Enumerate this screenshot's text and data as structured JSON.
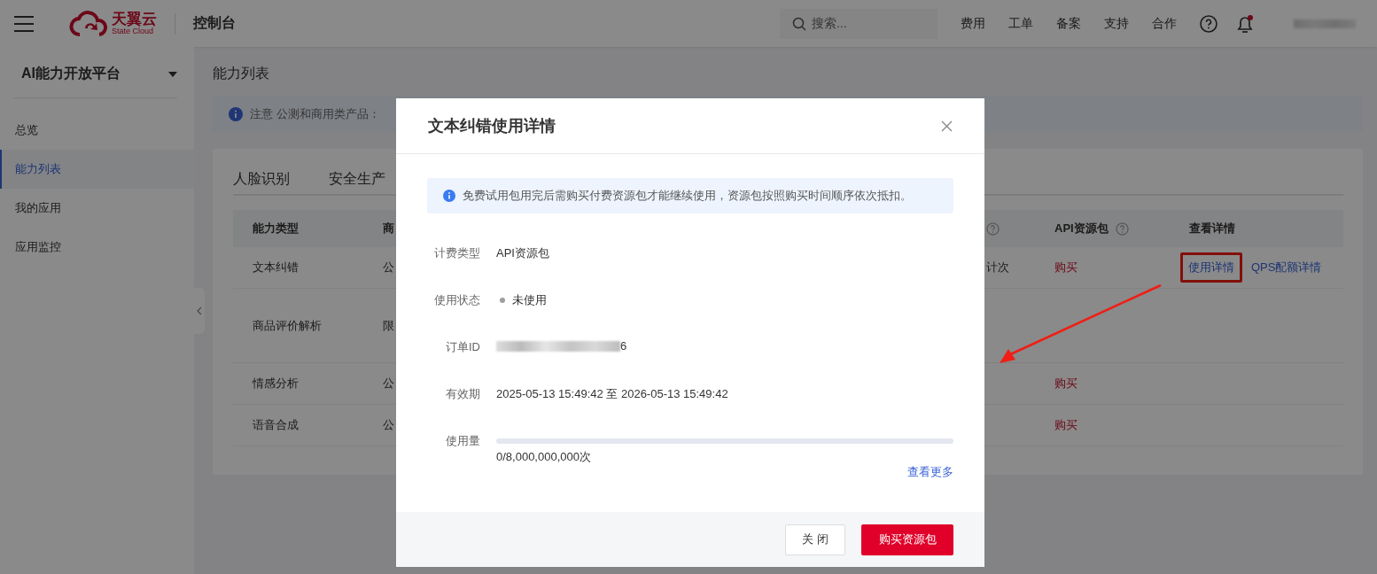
{
  "topbar": {
    "logo": {
      "name": "天翼云",
      "tagline": "State Cloud"
    },
    "title": "控制台",
    "search": {
      "placeholder": "搜索..."
    },
    "links": [
      "费用",
      "工单",
      "备案",
      "支持",
      "合作"
    ],
    "notifications": {
      "unread": true
    }
  },
  "sidebar": {
    "platform": "AI能力开放平台",
    "items": [
      {
        "label": "总览",
        "selected": false
      },
      {
        "label": "能力列表",
        "selected": true
      },
      {
        "label": "我的应用",
        "selected": false
      },
      {
        "label": "应用监控",
        "selected": false
      }
    ]
  },
  "page_title": "能力列表",
  "notice": "注意 公测和商用类产品：",
  "tabs": [
    {
      "label": "人脸识别",
      "selected": false
    },
    {
      "label": "安全生产",
      "selected": false
    }
  ],
  "table": {
    "columns": [
      {
        "label": "能力类型"
      },
      {
        "label": "商"
      },
      {
        "help": true
      },
      {
        "label": "API资源包",
        "help": true
      },
      {
        "label": "查看详情"
      }
    ],
    "rows": [
      {
        "type": "文本纠错",
        "column_2": "公",
        "column_3": "计次",
        "buy": "购买",
        "details": [
          {
            "label": "使用详情",
            "highlighted": true
          },
          {
            "label": "QPS配额详情",
            "highlighted": false
          }
        ]
      },
      {
        "type": "商品评价解析",
        "column_2": "限",
        "tall": true
      },
      {
        "type": "情感分析",
        "column_2": "公",
        "buy": "购买"
      },
      {
        "type": "语音合成",
        "column_2": "公",
        "buy": "购买"
      }
    ]
  },
  "modal": {
    "title": "文本纠错使用详情",
    "notice": "免费试用包用完后需购买付费资源包才能继续使用，资源包按照购买时间顺序依次抵扣。",
    "fields": [
      {
        "kind": "text",
        "label": "计费类型",
        "value": "API资源包"
      },
      {
        "kind": "status",
        "label": "使用状态",
        "value": "未使用",
        "color": "#9e9e9e"
      },
      {
        "kind": "redacted",
        "label": "订单ID",
        "value": "6"
      },
      {
        "kind": "text",
        "label": "有效期",
        "value": "2025-05-13 15:49:42 至 2026-05-13 15:49:42"
      },
      {
        "kind": "usage",
        "label": "使用量",
        "level": 0,
        "value": "0/8,000,000,000次"
      }
    ],
    "more_link": "查看更多",
    "buttons": [
      {
        "label": "关 闭",
        "kind": "secondary"
      },
      {
        "label": "购买资源包",
        "kind": "primary"
      }
    ]
  }
}
